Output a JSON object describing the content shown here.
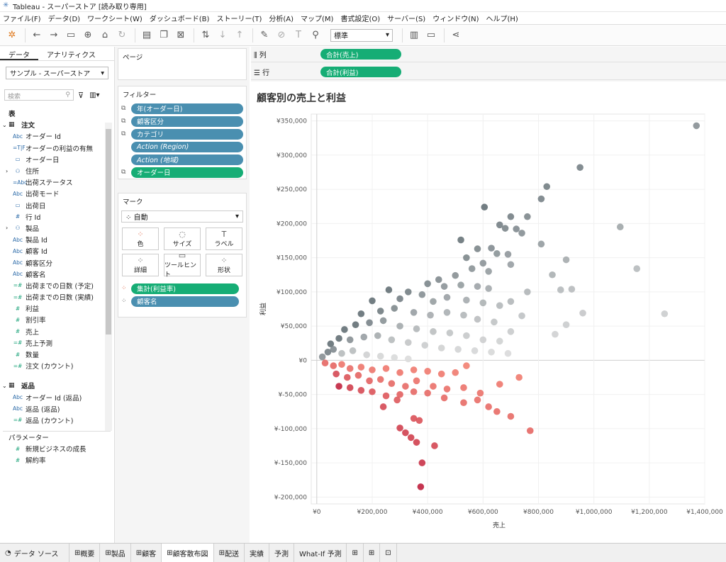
{
  "window": {
    "title": "Tableau - スーパーストア [読み取り専用]"
  },
  "menu": [
    "ファイル(F)",
    "データ(D)",
    "ワークシート(W)",
    "ダッシュボード(B)",
    "ストーリー(T)",
    "分析(A)",
    "マップ(M)",
    "書式設定(O)",
    "サーバー(S)",
    "ウィンドウ(N)",
    "ヘルプ(H)"
  ],
  "toolbar": {
    "fit": "標準"
  },
  "left": {
    "tabs": [
      "データ",
      "アナリティクス"
    ],
    "datasource": "サンプル - スーパーストア",
    "search_placeholder": "検索",
    "tables_label": "表",
    "orders_label": "注文",
    "order_fields": [
      {
        "type": "Abc",
        "name": "オーダー Id"
      },
      {
        "type": "=T|F",
        "name": "オーダーの利益の有無"
      },
      {
        "type": "cal",
        "name": "オーダー日"
      },
      {
        "type": "geo",
        "name": "住所",
        "expand": true
      },
      {
        "type": "=Abc",
        "name": "出荷ステータス"
      },
      {
        "type": "Abc",
        "name": "出荷モード"
      },
      {
        "type": "cal",
        "name": "出荷日"
      },
      {
        "type": "#",
        "name": "行 Id"
      },
      {
        "type": "hier",
        "name": "製品",
        "expand": true
      },
      {
        "type": "Abc",
        "name": "製品 Id"
      },
      {
        "type": "Abc",
        "name": "顧客 Id"
      },
      {
        "type": "Abc",
        "name": "顧客区分"
      },
      {
        "type": "Abc",
        "name": "顧客名"
      },
      {
        "type": "=#",
        "name": "出荷までの日数 (予定)",
        "measure": true
      },
      {
        "type": "=#",
        "name": "出荷までの日数 (実績)",
        "measure": true
      },
      {
        "type": "#",
        "name": "利益",
        "measure": true
      },
      {
        "type": "#",
        "name": "割引率",
        "measure": true
      },
      {
        "type": "#",
        "name": "売上",
        "measure": true
      },
      {
        "type": "=#",
        "name": "売上予測",
        "measure": true
      },
      {
        "type": "#",
        "name": "数量",
        "measure": true
      },
      {
        "type": "=#",
        "name": "注文 (カウント)",
        "measure": true
      }
    ],
    "returns_label": "返品",
    "return_fields": [
      {
        "type": "Abc",
        "name": "オーダー Id (返品)"
      },
      {
        "type": "Abc",
        "name": "返品 (返品)"
      },
      {
        "type": "=#",
        "name": "返品 (カウント)",
        "measure": true
      }
    ],
    "params_label": "パラメーター",
    "params": [
      "新規ビジネスの成長",
      "解約率"
    ]
  },
  "pages_label": "ページ",
  "filters_label": "フィルター",
  "filters": [
    {
      "name": "年(オーダー日)",
      "color": "blue"
    },
    {
      "name": "顧客区分",
      "color": "blue"
    },
    {
      "name": "カテゴリ",
      "color": "blue"
    },
    {
      "name": "Action (Region)",
      "color": "blue",
      "italic": true
    },
    {
      "name": "Action (地域)",
      "color": "blue",
      "italic": true
    },
    {
      "name": "オーダー日",
      "color": "green"
    }
  ],
  "marks": {
    "label": "マーク",
    "type": "自動",
    "buttons": [
      "色",
      "サイズ",
      "ラベル",
      "詳細",
      "ツールヒント",
      "形状"
    ],
    "pills": [
      {
        "name": "集計(利益率)",
        "color": "green"
      },
      {
        "name": "顧客名",
        "color": "blue"
      }
    ]
  },
  "shelves": {
    "columns_label": "列",
    "columns_pill": "合計(売上)",
    "rows_label": "行",
    "rows_pill": "合計(利益)"
  },
  "chart_data": {
    "type": "scatter",
    "title": "顧客別の売上と利益",
    "xlabel": "売上",
    "ylabel": "利益",
    "xlim": [
      -20000,
      1400000
    ],
    "ylim": [
      -210000,
      360000
    ],
    "x_ticks": [
      "¥0",
      "¥200,000",
      "¥400,000",
      "¥600,000",
      "¥800,000",
      "¥1,000,000",
      "¥1,200,000",
      "¥1,400,000"
    ],
    "y_ticks": [
      "¥350,000",
      "¥300,000",
      "¥250,000",
      "¥200,000",
      "¥150,000",
      "¥100,000",
      "¥50,000",
      "¥0",
      "¥-50,000",
      "¥-100,000",
      "¥-150,000",
      "¥-200,000"
    ],
    "color_encoding": "profit ratio (red negative, grey positive)",
    "points": [
      [
        1370000,
        343000
      ],
      [
        950000,
        282000
      ],
      [
        830000,
        254000
      ],
      [
        810000,
        236000
      ],
      [
        605000,
        224000
      ],
      [
        1095000,
        195000
      ],
      [
        700000,
        210000
      ],
      [
        760000,
        210000
      ],
      [
        660000,
        198000
      ],
      [
        680000,
        193000
      ],
      [
        720000,
        192000
      ],
      [
        740000,
        186000
      ],
      [
        520000,
        176000
      ],
      [
        810000,
        170000
      ],
      [
        1155000,
        134000
      ],
      [
        900000,
        147000
      ],
      [
        580000,
        163000
      ],
      [
        630000,
        164000
      ],
      [
        650000,
        156000
      ],
      [
        690000,
        155000
      ],
      [
        540000,
        150000
      ],
      [
        600000,
        142000
      ],
      [
        560000,
        134000
      ],
      [
        620000,
        130000
      ],
      [
        700000,
        140000
      ],
      [
        850000,
        125000
      ],
      [
        880000,
        103000
      ],
      [
        500000,
        124000
      ],
      [
        440000,
        118000
      ],
      [
        400000,
        112000
      ],
      [
        460000,
        108000
      ],
      [
        520000,
        110000
      ],
      [
        580000,
        108000
      ],
      [
        620000,
        105000
      ],
      [
        760000,
        100000
      ],
      [
        920000,
        104000
      ],
      [
        960000,
        69000
      ],
      [
        1255000,
        68000
      ],
      [
        900000,
        52000
      ],
      [
        860000,
        38000
      ],
      [
        740000,
        65000
      ],
      [
        330000,
        100000
      ],
      [
        260000,
        103000
      ],
      [
        300000,
        90000
      ],
      [
        380000,
        96000
      ],
      [
        420000,
        86000
      ],
      [
        470000,
        92000
      ],
      [
        540000,
        88000
      ],
      [
        600000,
        84000
      ],
      [
        660000,
        80000
      ],
      [
        700000,
        86000
      ],
      [
        200000,
        87000
      ],
      [
        160000,
        68000
      ],
      [
        230000,
        72000
      ],
      [
        280000,
        76000
      ],
      [
        350000,
        70000
      ],
      [
        410000,
        66000
      ],
      [
        470000,
        70000
      ],
      [
        530000,
        66000
      ],
      [
        580000,
        60000
      ],
      [
        640000,
        56000
      ],
      [
        700000,
        42000
      ],
      [
        100000,
        45000
      ],
      [
        140000,
        52000
      ],
      [
        190000,
        55000
      ],
      [
        240000,
        58000
      ],
      [
        300000,
        50000
      ],
      [
        360000,
        46000
      ],
      [
        420000,
        42000
      ],
      [
        480000,
        40000
      ],
      [
        540000,
        36000
      ],
      [
        600000,
        30000
      ],
      [
        660000,
        28000
      ],
      [
        50000,
        24000
      ],
      [
        80000,
        32000
      ],
      [
        120000,
        30000
      ],
      [
        170000,
        34000
      ],
      [
        220000,
        36000
      ],
      [
        270000,
        30000
      ],
      [
        330000,
        26000
      ],
      [
        390000,
        22000
      ],
      [
        450000,
        18000
      ],
      [
        510000,
        16000
      ],
      [
        570000,
        14000
      ],
      [
        630000,
        12000
      ],
      [
        690000,
        10000
      ],
      [
        20000,
        5000
      ],
      [
        40000,
        12000
      ],
      [
        60000,
        16000
      ],
      [
        90000,
        10000
      ],
      [
        130000,
        14000
      ],
      [
        180000,
        8000
      ],
      [
        230000,
        6000
      ],
      [
        280000,
        4000
      ],
      [
        330000,
        2000
      ],
      [
        30000,
        -4000
      ],
      [
        60000,
        -8000
      ],
      [
        90000,
        -6000
      ],
      [
        120000,
        -12000
      ],
      [
        160000,
        -10000
      ],
      [
        200000,
        -14000
      ],
      [
        250000,
        -12000
      ],
      [
        300000,
        -18000
      ],
      [
        350000,
        -14000
      ],
      [
        400000,
        -16000
      ],
      [
        450000,
        -20000
      ],
      [
        500000,
        -18000
      ],
      [
        540000,
        -8000
      ],
      [
        730000,
        -25000
      ],
      [
        70000,
        -20000
      ],
      [
        110000,
        -25000
      ],
      [
        150000,
        -22000
      ],
      [
        190000,
        -30000
      ],
      [
        230000,
        -28000
      ],
      [
        270000,
        -34000
      ],
      [
        320000,
        -38000
      ],
      [
        360000,
        -30000
      ],
      [
        420000,
        -38000
      ],
      [
        470000,
        -42000
      ],
      [
        530000,
        -40000
      ],
      [
        590000,
        -48000
      ],
      [
        660000,
        -35000
      ],
      [
        80000,
        -38000
      ],
      [
        120000,
        -40000
      ],
      [
        160000,
        -44000
      ],
      [
        200000,
        -46000
      ],
      [
        250000,
        -52000
      ],
      [
        300000,
        -50000
      ],
      [
        350000,
        -46000
      ],
      [
        400000,
        -48000
      ],
      [
        460000,
        -55000
      ],
      [
        530000,
        -62000
      ],
      [
        580000,
        -58000
      ],
      [
        620000,
        -68000
      ],
      [
        650000,
        -75000
      ],
      [
        700000,
        -82000
      ],
      [
        240000,
        -68000
      ],
      [
        290000,
        -58000
      ],
      [
        350000,
        -85000
      ],
      [
        370000,
        -88000
      ],
      [
        320000,
        -106000
      ],
      [
        300000,
        -99000
      ],
      [
        340000,
        -113000
      ],
      [
        360000,
        -120000
      ],
      [
        425000,
        -125000
      ],
      [
        380000,
        -150000
      ],
      [
        375000,
        -185000
      ],
      [
        770000,
        -103000
      ]
    ]
  },
  "sheets": [
    "データ ソース",
    "概要",
    "製品",
    "顧客",
    "顧客散布図",
    "配送",
    "実績",
    "予測",
    "What-If 予測"
  ],
  "active_sheet": "顧客散布図"
}
